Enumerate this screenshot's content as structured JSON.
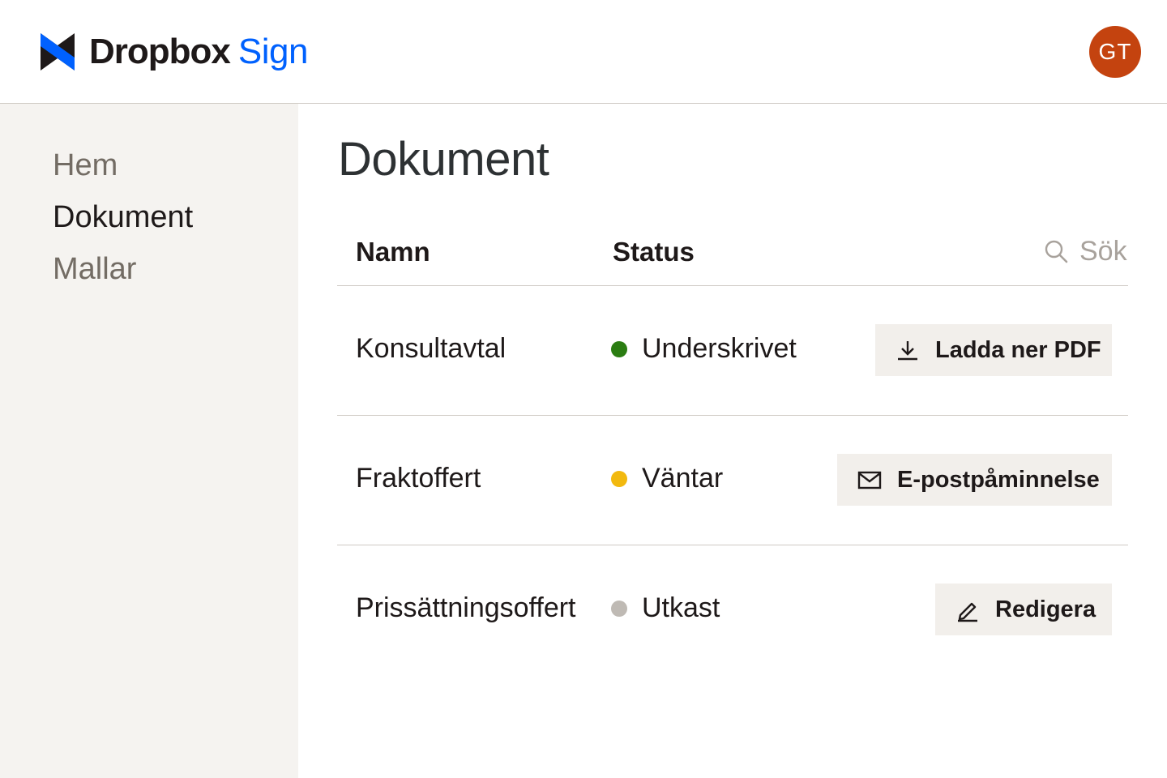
{
  "app": {
    "brand_primary": "Dropbox",
    "brand_secondary": "Sign",
    "brand_color": "#0061fe",
    "avatar_initials": "GT",
    "avatar_color": "#c4430f"
  },
  "sidebar": {
    "items": [
      {
        "label": "Hem",
        "active": false
      },
      {
        "label": "Dokument",
        "active": true
      },
      {
        "label": "Mallar",
        "active": false
      }
    ]
  },
  "main": {
    "title": "Dokument",
    "columns": {
      "name": "Namn",
      "status": "Status"
    },
    "search": {
      "placeholder": "Sök",
      "icon": "search-icon"
    },
    "rows": [
      {
        "name": "Konsultavtal",
        "status": "Underskrivet",
        "status_color": "#2b7d12",
        "action": "Ladda ner PDF",
        "action_icon": "download-icon"
      },
      {
        "name": "Fraktoffert",
        "status": "Väntar",
        "status_color": "#f2b90f",
        "action": "E-postpåminnelse",
        "action_icon": "mail-icon"
      },
      {
        "name": "Prissättningsoffert",
        "status": "Utkast",
        "status_color": "#bfbab4",
        "action": "Redigera",
        "action_icon": "edit-icon"
      }
    ]
  }
}
